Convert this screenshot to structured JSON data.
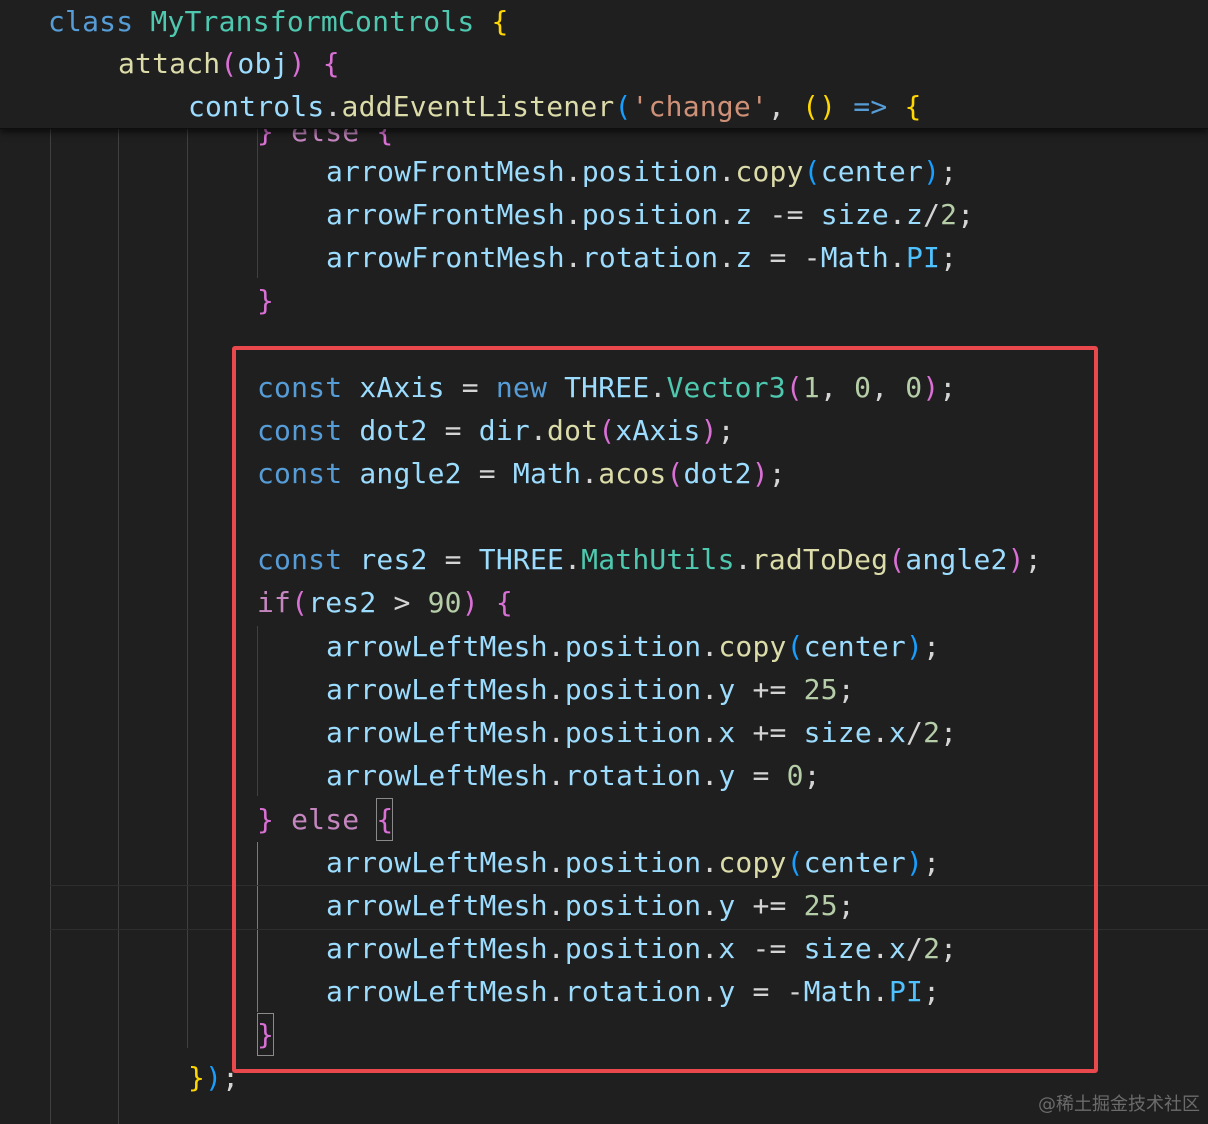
{
  "sticky_scroll": [
    {
      "tokens": [
        [
          "kw",
          "class"
        ],
        [
          "pun",
          " "
        ],
        [
          "cls",
          "MyTransformControls"
        ],
        [
          "pun",
          " "
        ],
        [
          "b1",
          "{"
        ]
      ]
    },
    {
      "tokens": [
        [
          "fn",
          "attach"
        ],
        [
          "b2",
          "("
        ],
        [
          "var",
          "obj"
        ],
        [
          "b2",
          ")"
        ],
        [
          "pun",
          " "
        ],
        [
          "b2",
          "{"
        ]
      ]
    },
    {
      "tokens": [
        [
          "var",
          "controls"
        ],
        [
          "pun",
          "."
        ],
        [
          "fn",
          "addEventListener"
        ],
        [
          "b3",
          "("
        ],
        [
          "str",
          "'change'"
        ],
        [
          "pun",
          ", "
        ],
        [
          "b1",
          "()"
        ],
        [
          "pun",
          " "
        ],
        [
          "kw",
          "=>"
        ],
        [
          "pun",
          " "
        ],
        [
          "b1",
          "{"
        ]
      ]
    }
  ],
  "code_lines": [
    {
      "tokens": [
        [
          "b2",
          "}"
        ],
        [
          "pun",
          " "
        ],
        [
          "ctl",
          "else"
        ],
        [
          "pun",
          " "
        ],
        [
          "b2",
          "{"
        ]
      ]
    },
    {
      "tokens": [
        [
          "var",
          "arrowFrontMesh"
        ],
        [
          "pun",
          "."
        ],
        [
          "var",
          "position"
        ],
        [
          "pun",
          "."
        ],
        [
          "fn",
          "copy"
        ],
        [
          "b3",
          "("
        ],
        [
          "var",
          "center"
        ],
        [
          "b3",
          ")"
        ],
        [
          "pun",
          ";"
        ]
      ]
    },
    {
      "tokens": [
        [
          "var",
          "arrowFrontMesh"
        ],
        [
          "pun",
          "."
        ],
        [
          "var",
          "position"
        ],
        [
          "pun",
          "."
        ],
        [
          "var",
          "z"
        ],
        [
          "pun",
          " -= "
        ],
        [
          "var",
          "size"
        ],
        [
          "pun",
          "."
        ],
        [
          "var",
          "z"
        ],
        [
          "pun",
          "/"
        ],
        [
          "num",
          "2"
        ],
        [
          "pun",
          ";"
        ]
      ]
    },
    {
      "tokens": [
        [
          "var",
          "arrowFrontMesh"
        ],
        [
          "pun",
          "."
        ],
        [
          "var",
          "rotation"
        ],
        [
          "pun",
          "."
        ],
        [
          "var",
          "z"
        ],
        [
          "pun",
          " = -"
        ],
        [
          "var",
          "Math"
        ],
        [
          "pun",
          "."
        ],
        [
          "const",
          "PI"
        ],
        [
          "pun",
          ";"
        ]
      ]
    },
    {
      "tokens": [
        [
          "b2",
          "}"
        ]
      ]
    },
    {
      "tokens": []
    },
    {
      "tokens": [
        [
          "kw",
          "const"
        ],
        [
          "pun",
          " "
        ],
        [
          "var",
          "xAxis"
        ],
        [
          "pun",
          " = "
        ],
        [
          "kw",
          "new"
        ],
        [
          "pun",
          " "
        ],
        [
          "var",
          "THREE"
        ],
        [
          "pun",
          "."
        ],
        [
          "cls",
          "Vector3"
        ],
        [
          "b2",
          "("
        ],
        [
          "num",
          "1"
        ],
        [
          "pun",
          ", "
        ],
        [
          "num",
          "0"
        ],
        [
          "pun",
          ", "
        ],
        [
          "num",
          "0"
        ],
        [
          "b2",
          ")"
        ],
        [
          "pun",
          ";"
        ]
      ]
    },
    {
      "tokens": [
        [
          "kw",
          "const"
        ],
        [
          "pun",
          " "
        ],
        [
          "var",
          "dot2"
        ],
        [
          "pun",
          " = "
        ],
        [
          "var",
          "dir"
        ],
        [
          "pun",
          "."
        ],
        [
          "fn",
          "dot"
        ],
        [
          "b2",
          "("
        ],
        [
          "var",
          "xAxis"
        ],
        [
          "b2",
          ")"
        ],
        [
          "pun",
          ";"
        ]
      ]
    },
    {
      "tokens": [
        [
          "kw",
          "const"
        ],
        [
          "pun",
          " "
        ],
        [
          "var",
          "angle2"
        ],
        [
          "pun",
          " = "
        ],
        [
          "var",
          "Math"
        ],
        [
          "pun",
          "."
        ],
        [
          "fn",
          "acos"
        ],
        [
          "b2",
          "("
        ],
        [
          "var",
          "dot2"
        ],
        [
          "b2",
          ")"
        ],
        [
          "pun",
          ";"
        ]
      ]
    },
    {
      "tokens": []
    },
    {
      "tokens": [
        [
          "kw",
          "const"
        ],
        [
          "pun",
          " "
        ],
        [
          "var",
          "res2"
        ],
        [
          "pun",
          " = "
        ],
        [
          "var",
          "THREE"
        ],
        [
          "pun",
          "."
        ],
        [
          "cls",
          "MathUtils"
        ],
        [
          "pun",
          "."
        ],
        [
          "fn",
          "radToDeg"
        ],
        [
          "b2",
          "("
        ],
        [
          "var",
          "angle2"
        ],
        [
          "b2",
          ")"
        ],
        [
          "pun",
          ";"
        ]
      ]
    },
    {
      "tokens": [
        [
          "ctl",
          "if"
        ],
        [
          "b2",
          "("
        ],
        [
          "var",
          "res2"
        ],
        [
          "pun",
          " > "
        ],
        [
          "num",
          "90"
        ],
        [
          "b2",
          ")"
        ],
        [
          "pun",
          " "
        ],
        [
          "b2",
          "{"
        ]
      ]
    },
    {
      "tokens": [
        [
          "var",
          "arrowLeftMesh"
        ],
        [
          "pun",
          "."
        ],
        [
          "var",
          "position"
        ],
        [
          "pun",
          "."
        ],
        [
          "fn",
          "copy"
        ],
        [
          "b3",
          "("
        ],
        [
          "var",
          "center"
        ],
        [
          "b3",
          ")"
        ],
        [
          "pun",
          ";"
        ]
      ]
    },
    {
      "tokens": [
        [
          "var",
          "arrowLeftMesh"
        ],
        [
          "pun",
          "."
        ],
        [
          "var",
          "position"
        ],
        [
          "pun",
          "."
        ],
        [
          "var",
          "y"
        ],
        [
          "pun",
          " += "
        ],
        [
          "num",
          "25"
        ],
        [
          "pun",
          ";"
        ]
      ]
    },
    {
      "tokens": [
        [
          "var",
          "arrowLeftMesh"
        ],
        [
          "pun",
          "."
        ],
        [
          "var",
          "position"
        ],
        [
          "pun",
          "."
        ],
        [
          "var",
          "x"
        ],
        [
          "pun",
          " += "
        ],
        [
          "var",
          "size"
        ],
        [
          "pun",
          "."
        ],
        [
          "var",
          "x"
        ],
        [
          "pun",
          "/"
        ],
        [
          "num",
          "2"
        ],
        [
          "pun",
          ";"
        ]
      ]
    },
    {
      "tokens": [
        [
          "var",
          "arrowLeftMesh"
        ],
        [
          "pun",
          "."
        ],
        [
          "var",
          "rotation"
        ],
        [
          "pun",
          "."
        ],
        [
          "var",
          "y"
        ],
        [
          "pun",
          " = "
        ],
        [
          "num",
          "0"
        ],
        [
          "pun",
          ";"
        ]
      ]
    },
    {
      "tokens": [
        [
          "b2",
          "}"
        ],
        [
          "pun",
          " "
        ],
        [
          "ctl",
          "else"
        ],
        [
          "pun",
          " "
        ],
        [
          "b2",
          "{"
        ]
      ]
    },
    {
      "tokens": [
        [
          "var",
          "arrowLeftMesh"
        ],
        [
          "pun",
          "."
        ],
        [
          "var",
          "position"
        ],
        [
          "pun",
          "."
        ],
        [
          "fn",
          "copy"
        ],
        [
          "b3",
          "("
        ],
        [
          "var",
          "center"
        ],
        [
          "b3",
          ")"
        ],
        [
          "pun",
          ";"
        ]
      ]
    },
    {
      "tokens": [
        [
          "var",
          "arrowLeftMesh"
        ],
        [
          "pun",
          "."
        ],
        [
          "var",
          "position"
        ],
        [
          "pun",
          "."
        ],
        [
          "var",
          "y"
        ],
        [
          "pun",
          " += "
        ],
        [
          "num",
          "25"
        ],
        [
          "pun",
          ";"
        ]
      ]
    },
    {
      "tokens": [
        [
          "var",
          "arrowLeftMesh"
        ],
        [
          "pun",
          "."
        ],
        [
          "var",
          "position"
        ],
        [
          "pun",
          "."
        ],
        [
          "var",
          "x"
        ],
        [
          "pun",
          " -= "
        ],
        [
          "var",
          "size"
        ],
        [
          "pun",
          "."
        ],
        [
          "var",
          "x"
        ],
        [
          "pun",
          "/"
        ],
        [
          "num",
          "2"
        ],
        [
          "pun",
          ";"
        ]
      ]
    },
    {
      "tokens": [
        [
          "var",
          "arrowLeftMesh"
        ],
        [
          "pun",
          "."
        ],
        [
          "var",
          "rotation"
        ],
        [
          "pun",
          "."
        ],
        [
          "var",
          "y"
        ],
        [
          "pun",
          " = -"
        ],
        [
          "var",
          "Math"
        ],
        [
          "pun",
          "."
        ],
        [
          "const",
          "PI"
        ],
        [
          "pun",
          ";"
        ]
      ]
    },
    {
      "tokens": [
        [
          "b2",
          "}"
        ]
      ]
    },
    {
      "tokens": [
        [
          "b1",
          "}"
        ],
        [
          "b3",
          ")"
        ],
        [
          "pun",
          ";"
        ]
      ]
    }
  ],
  "watermark": "@稀土掘金技术社区",
  "colors": {
    "background": "#1f1f1f",
    "highlight_box": "#e9484c"
  }
}
